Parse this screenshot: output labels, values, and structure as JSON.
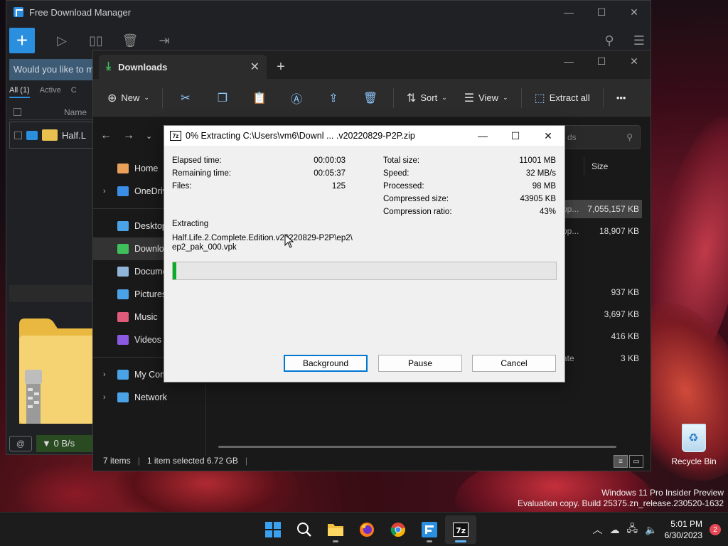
{
  "fdm": {
    "title": "Free Download Manager",
    "notice": "Would you like to m",
    "tabs": [
      "All (1)",
      "Active",
      "C"
    ],
    "col_name": "Name",
    "row_name": "Half.L",
    "speed": "0 B/s"
  },
  "explorer": {
    "tab_title": "Downloads",
    "cmd": {
      "new": "New",
      "sort": "Sort",
      "view": "View",
      "extract_all": "Extract all",
      "more": "•••"
    },
    "search_placeholder": "ds",
    "sidebar": [
      {
        "label": "Home",
        "icon": "home-icon",
        "chev": "",
        "color": "#e9a05a"
      },
      {
        "label": "OneDrive",
        "icon": "cloud-icon",
        "chev": "›",
        "color": "#3a8ee6"
      },
      {
        "label": "Desktop",
        "icon": "desktop-icon",
        "chev": "",
        "color": "#4aa3e6"
      },
      {
        "label": "Downloads",
        "icon": "download-icon",
        "chev": "",
        "color": "#3fc05a"
      },
      {
        "label": "Documents",
        "icon": "document-icon",
        "chev": "",
        "color": "#8fb5d8"
      },
      {
        "label": "Pictures",
        "icon": "pictures-icon",
        "chev": "",
        "color": "#4aa3e6"
      },
      {
        "label": "Music",
        "icon": "music-icon",
        "chev": "",
        "color": "#e05a7a"
      },
      {
        "label": "Videos",
        "icon": "videos-icon",
        "chev": "",
        "color": "#8a5ae0"
      },
      {
        "label": "My Computer",
        "icon": "computer-icon",
        "chev": "›",
        "color": "#4aa3e6"
      },
      {
        "label": "Network",
        "icon": "network-icon",
        "chev": "›",
        "color": "#4aa3e6"
      }
    ],
    "col_size": "Size",
    "files": [
      {
        "left": "pp...",
        "size": "7,055,157 KB"
      },
      {
        "left": "pp...",
        "size": "18,907 KB"
      },
      {
        "left": "",
        "size": "937 KB"
      },
      {
        "left": "",
        "size": "3,697 KB"
      },
      {
        "left": "",
        "size": "416 KB"
      },
      {
        "left": "ate",
        "size": "3 KB"
      }
    ],
    "status": {
      "items": "7 items",
      "selected": "1 item selected  6.72 GB"
    }
  },
  "dialog": {
    "title": "0% Extracting C:\\Users\\vm6\\Downl ... .v20220829-P2P.zip",
    "left_stats": [
      {
        "label": "Elapsed time:",
        "value": "00:00:03"
      },
      {
        "label": "Remaining time:",
        "value": "00:05:37"
      },
      {
        "label": "Files:",
        "value": "125"
      }
    ],
    "right_stats": [
      {
        "label": "Total size:",
        "value": "11001 MB"
      },
      {
        "label": "Speed:",
        "value": "32 MB/s"
      },
      {
        "label": "Processed:",
        "value": "98 MB"
      },
      {
        "label": "Compressed size:",
        "value": "43905 KB"
      },
      {
        "label": "Compression ratio:",
        "value": "43%"
      }
    ],
    "extracting_label": "Extracting",
    "path_line1": "Half.Life.2.Complete.Edition.v20220829-P2P\\ep2\\",
    "path_line2": "ep2_pak_000.vpk",
    "progress_fraction": 0.01,
    "buttons": {
      "background": "Background",
      "pause": "Pause",
      "cancel": "Cancel"
    }
  },
  "desktop": {
    "recycle_bin": "Recycle Bin",
    "watermark_line1": "Windows 11 Pro Insider Preview",
    "watermark_line2": "Evaluation copy. Build 25375.zn_release.230520-1632"
  },
  "taskbar": {
    "time": "5:01 PM",
    "date": "6/30/2023",
    "notifications": "2"
  }
}
